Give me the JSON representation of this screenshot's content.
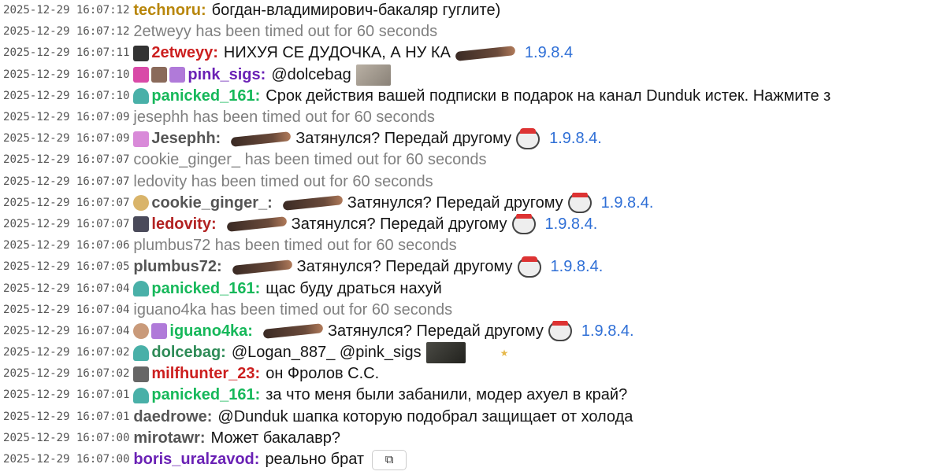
{
  "chat": {
    "rows": [
      {
        "ts": "2025-12-29 16:07:12",
        "user": "technoru:",
        "color": "#b8860b",
        "msg": "богдан-владимирович-бакаляр гуглите)"
      },
      {
        "ts": "2025-12-29 16:07:12",
        "sys": "2etweyy has been timed out for 60 seconds"
      },
      {
        "ts": "2025-12-29 16:07:11",
        "badges": [
          "mute-icon"
        ],
        "user": "2etweyy:",
        "color": "#cc1f1f",
        "msg": "НИХУЯ СЕ ДУДОЧКА, А НУ КА",
        "emote": "joint",
        "link": "1.9.8.4"
      },
      {
        "ts": "2025-12-29 16:07:10",
        "badges": [
          "heart-badge-icon",
          "animal-badge-icon",
          "sub-badge-icon"
        ],
        "user": "pink_sigs:",
        "color": "#6a21b5",
        "msg": "@dolcebag",
        "thumb": "thumb1"
      },
      {
        "ts": "2025-12-29 16:07:10",
        "badges": [
          "sprite-badge-icon"
        ],
        "user": "panicked_161:",
        "color": "#16b85a",
        "msg": "Срок действия вашей подписки в подарок на канал Dunduk истек. Нажмите з"
      },
      {
        "ts": "2025-12-29 16:07:09",
        "sys": "jesephh has been timed out for 60 seconds"
      },
      {
        "ts": "2025-12-29 16:07:09",
        "badges": [
          "gift-badge-icon"
        ],
        "user": "Jesephh:",
        "color": "#555555",
        "emote_before": "joint",
        "msg": "Затянулся? Передай другому",
        "emote": "santa",
        "link": "1.9.8.4."
      },
      {
        "ts": "2025-12-29 16:07:07",
        "sys": "cookie_ginger_ has been timed out for 60 seconds"
      },
      {
        "ts": "2025-12-29 16:07:07",
        "sys": "ledovity has been timed out for 60 seconds"
      },
      {
        "ts": "2025-12-29 16:07:07",
        "badges": [
          "face-badge-icon"
        ],
        "user": "cookie_ginger_:",
        "color": "#555555",
        "emote_before": "joint",
        "msg": "Затянулся? Передай другому",
        "emote": "santa",
        "link": "1.9.8.4."
      },
      {
        "ts": "2025-12-29 16:07:07",
        "badges": [
          "robot-badge-icon"
        ],
        "user": "ledovity:",
        "color": "#b22222",
        "emote_before": "joint",
        "msg": "Затянулся? Передай другому",
        "emote": "santa",
        "link": "1.9.8.4."
      },
      {
        "ts": "2025-12-29 16:07:06",
        "sys": "plumbus72 has been timed out for 60 seconds"
      },
      {
        "ts": "2025-12-29 16:07:05",
        "user": "plumbus72:",
        "color": "#555555",
        "emote_before": "joint",
        "msg": "Затянулся? Передай другому",
        "emote": "santa",
        "link": "1.9.8.4."
      },
      {
        "ts": "2025-12-29 16:07:04",
        "badges": [
          "sprite-badge-icon"
        ],
        "user": "panicked_161:",
        "color": "#16b85a",
        "msg": "щас буду драться нахуй"
      },
      {
        "ts": "2025-12-29 16:07:04",
        "sys": "iguano4ka has been timed out for 60 seconds"
      },
      {
        "ts": "2025-12-29 16:07:04",
        "badges": [
          "old-face-badge-icon",
          "sub-badge-icon"
        ],
        "user": "iguano4ka:",
        "color": "#16b85a",
        "emote_before": "joint",
        "msg": "Затянулся? Передай другому",
        "emote": "santa",
        "link": "1.9.8.4."
      },
      {
        "ts": "2025-12-29 16:07:02",
        "badges": [
          "sprite-badge-icon"
        ],
        "user": "dolcebag:",
        "color": "#2e8b57",
        "msg": "@Logan_887_ @pink_sigs",
        "thumb": "thumb2",
        "star": true
      },
      {
        "ts": "2025-12-29 16:07:02",
        "badges": [
          "gray-badge-icon"
        ],
        "user": "milfhunter_23:",
        "color": "#cc1f1f",
        "msg": "он Фролов С.С."
      },
      {
        "ts": "2025-12-29 16:07:01",
        "badges": [
          "sprite-badge-icon"
        ],
        "user": "panicked_161:",
        "color": "#16b85a",
        "msg": "за что меня были забанили, модер ахуел в край?"
      },
      {
        "ts": "2025-12-29 16:07:01",
        "user": "daedrowe:",
        "color": "#555555",
        "msg": "@Dunduk шапка которую подобрал защищает от холода"
      },
      {
        "ts": "2025-12-29 16:07:00",
        "user": "mirotawr:",
        "color": "#555555",
        "msg": "Может бакалавр?"
      },
      {
        "ts": "2025-12-29 16:07:00",
        "user": "boris_uralzavod:",
        "color": "#6a21b5",
        "msg": "реально брат",
        "ext": "external-link-icon"
      }
    ],
    "ext_glyph": "⧉"
  }
}
